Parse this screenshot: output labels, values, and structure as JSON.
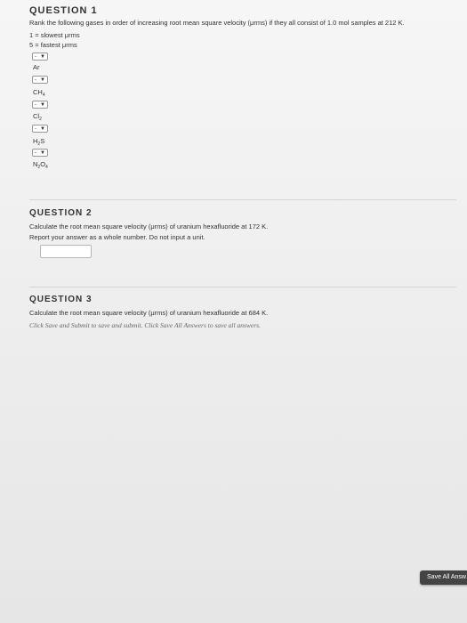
{
  "q1": {
    "title": "QUESTION 1",
    "prompt": "Rank the following gases in order of increasing root mean square velocity (μrms) if they all consist of 1.0 mol samples at 212 K.",
    "legend_low": "1 = slowest μrms",
    "legend_high": "5 = fastest μrms",
    "select_default": "-",
    "gases": [
      "Ar",
      "CH4",
      "Cl2",
      "H2S",
      "N2O4"
    ]
  },
  "q2": {
    "title": "QUESTION 2",
    "prompt": "Calculate the root mean square velocity (μrms) of uranium hexafluoride at 172 K.",
    "instruction": "Report your answer as a whole number. Do not input a unit."
  },
  "q3": {
    "title": "QUESTION 3",
    "prompt": "Calculate the root mean square velocity (μrms) of uranium hexafluoride at 684 K."
  },
  "footer": {
    "note": "Click Save and Submit to save and submit. Click Save All Answers to save all answers.",
    "save_all_label": "Save All Answ"
  }
}
